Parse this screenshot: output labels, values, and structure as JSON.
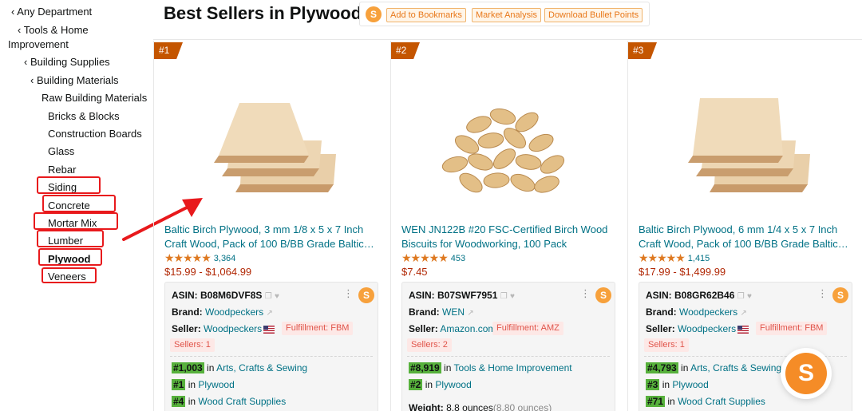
{
  "sidebar": {
    "items": [
      {
        "label": "‹ Any Department"
      },
      {
        "label": "‹ Tools & Home"
      },
      {
        "label": "Improvement"
      },
      {
        "label": "‹ Building Supplies"
      },
      {
        "label": "‹ Building Materials"
      },
      {
        "label": "Raw Building Materials"
      },
      {
        "label": "Bricks & Blocks"
      },
      {
        "label": "Construction Boards"
      },
      {
        "label": "Glass"
      },
      {
        "label": "Rebar"
      },
      {
        "label": "Siding"
      },
      {
        "label": "Concrete"
      },
      {
        "label": "Mortar Mix"
      },
      {
        "label": "Lumber"
      },
      {
        "label": "Plywood"
      },
      {
        "label": "Veneers"
      }
    ],
    "highlight_color": "#e8191c"
  },
  "header": {
    "title": "Best Sellers in Plywood",
    "logo_glyph": "S",
    "buttons": [
      "Add to Bookmarks",
      "Market Analysis",
      "Download Bullet Points"
    ]
  },
  "products": [
    {
      "rank": "#1",
      "title": "Baltic Birch Plywood, 3 mm 1/8 x 5 x 7 Inch Craft Wood, Pack of 100 B/BB Grade Baltic…",
      "stars": "★★★★★",
      "rating": 4.6,
      "rating_count": "3,364",
      "price": "$15.99 - $1,064.99",
      "asin_label": "ASIN:",
      "asin": "B08M6DVF8S",
      "brand_label": "Brand:",
      "brand": "Woodpeckers",
      "seller_label": "Seller:",
      "seller": "Woodpeckers",
      "fulfillment": "Fulfillment: FBM",
      "sellers": "Sellers: 1",
      "ranks": [
        {
          "num": "#1,003",
          "in": "in",
          "cat": "Arts, Crafts & Sewing"
        },
        {
          "num": "#1",
          "in": "in",
          "cat": "Plywood"
        },
        {
          "num": "#4",
          "in": "in",
          "cat": "Wood Craft Supplies"
        }
      ]
    },
    {
      "rank": "#2",
      "title": "WEN JN122B #20 FSC-Certified Birch Wood Biscuits for Woodworking, 100 Pack",
      "stars": "★★★★★",
      "rating": 4.6,
      "rating_count": "453",
      "price": "$7.45",
      "asin_label": "ASIN:",
      "asin": "B07SWF7951",
      "brand_label": "Brand:",
      "brand": "WEN",
      "seller_label": "Seller:",
      "seller": "Amazon.com",
      "fulfillment": "Fulfillment: AMZ",
      "sellers": "Sellers: 2",
      "ranks": [
        {
          "num": "#8,919",
          "in": "in",
          "cat": "Tools & Home Improvement"
        },
        {
          "num": "#2",
          "in": "in",
          "cat": "Plywood"
        }
      ],
      "weight_label": "Weight:",
      "weight": "8.8 ounces",
      "weight_alt": "(8.80 ounces)"
    },
    {
      "rank": "#3",
      "title": "Baltic Birch Plywood, 6 mm 1/4 x 5 x 7 Inch Craft Wood, Pack of 100 B/BB Grade Baltic…",
      "stars": "★★★★★",
      "rating": 4.6,
      "rating_count": "1,415",
      "price": "$17.99 - $1,499.99",
      "asin_label": "ASIN:",
      "asin": "B08GR62B46",
      "brand_label": "Brand:",
      "brand": "Woodpeckers",
      "seller_label": "Seller:",
      "seller": "Woodpeckers",
      "fulfillment": "Fulfillment: FBM",
      "sellers": "Sellers: 1",
      "ranks": [
        {
          "num": "#4,793",
          "in": "in",
          "cat": "Arts, Crafts & Sewing"
        },
        {
          "num": "#3",
          "in": "in",
          "cat": "Plywood"
        },
        {
          "num": "#71",
          "in": "in",
          "cat": "Wood Craft Supplies"
        }
      ]
    }
  ],
  "floating_logo_glyph": "S",
  "colors": {
    "accent_orange": "#f7a13c",
    "rank_badge": "#c45500",
    "link": "#007185",
    "price": "#b12704",
    "rank_green": "#57b13c",
    "annotation_red": "#e8191c"
  }
}
